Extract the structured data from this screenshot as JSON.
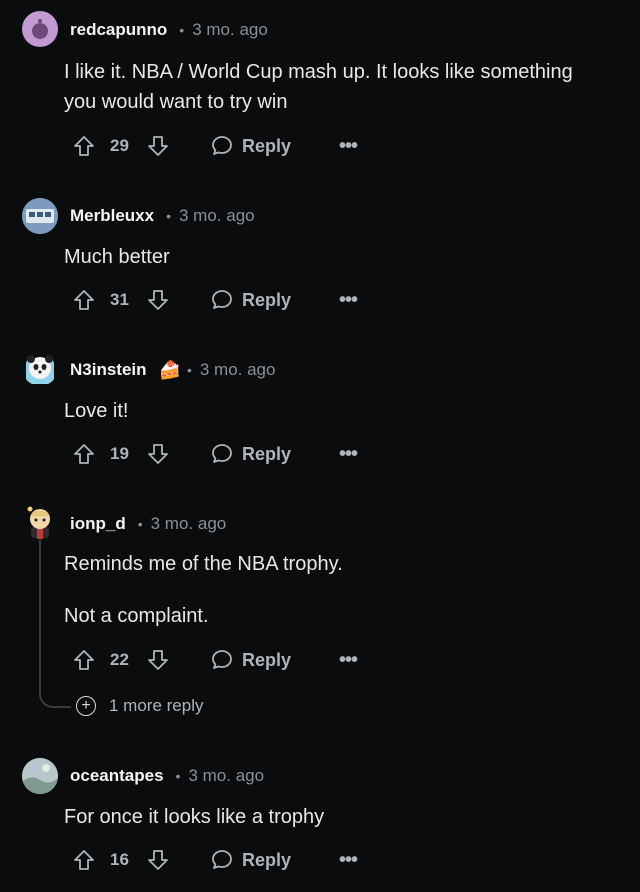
{
  "comments": [
    {
      "user": "redcapunno",
      "time": "3 mo. ago",
      "flair": "",
      "lines": [
        "I like it. NBA / World Cup mash up. It looks like something you would want to try win"
      ],
      "score": "29",
      "reply": "Reply",
      "avatar_color": "#c39bd3"
    },
    {
      "user": "Merbleuxx",
      "time": "3 mo. ago",
      "flair": "",
      "lines": [
        "Much better"
      ],
      "score": "31",
      "reply": "Reply",
      "avatar_color": "#5b7fa8"
    },
    {
      "user": "N3instein",
      "time": "3 mo. ago",
      "flair": "🍰",
      "lines": [
        "Love it!"
      ],
      "score": "19",
      "reply": "Reply",
      "avatar_color": "#8fd3e8"
    },
    {
      "user": "ionp_d",
      "time": "3 mo. ago",
      "flair": "",
      "lines": [
        "Reminds me of the NBA trophy.",
        "Not a complaint."
      ],
      "score": "22",
      "reply": "Reply",
      "avatar_color": "#e8c87a",
      "more_replies": "1 more reply"
    },
    {
      "user": "oceantapes",
      "time": "3 mo. ago",
      "flair": "",
      "lines": [
        "For once it looks like a trophy"
      ],
      "score": "16",
      "reply": "Reply",
      "avatar_color": "#9fb3b8"
    }
  ],
  "colors": {
    "background": "#0b0c0e",
    "muted": "#8a9196",
    "text": "#e6e8ea"
  },
  "icons": [
    "upvote-icon",
    "downvote-icon",
    "comment-bubble-icon",
    "more-options-icon",
    "expand-plus-icon"
  ]
}
